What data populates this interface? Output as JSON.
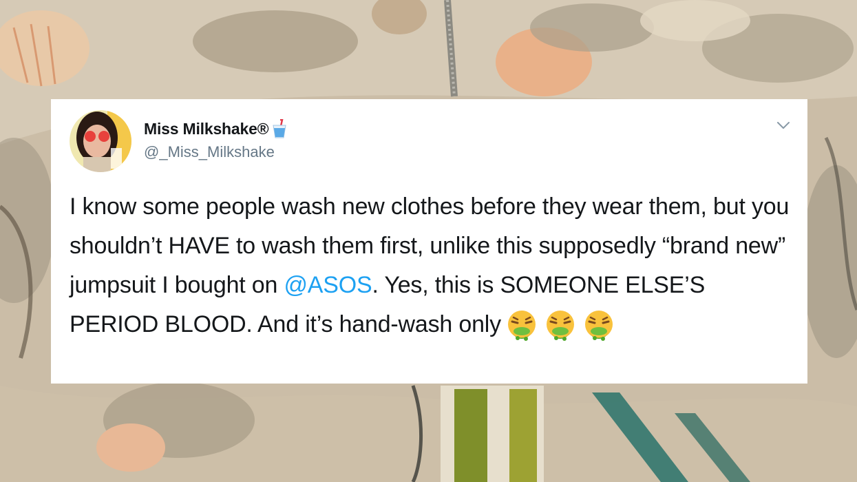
{
  "tweet": {
    "display_name": "Miss Milkshake®",
    "name_emoji": "cup-with-straw-icon",
    "handle": "@_Miss_Milkshake",
    "text_before_mention": "I know some people wash new clothes before they wear them, but you shouldn’t HAVE to wash them first, unlike this supposedly “brand new” jumpsuit I bought on ",
    "mention": "@ASOS",
    "text_after_mention": ". Yes, this is SOMEONE ELSE’S PERIOD BLOOD. And it’s hand-wash only",
    "trailing_emoji": [
      "face-vomiting-icon",
      "face-vomiting-icon",
      "face-vomiting-icon"
    ]
  },
  "colors": {
    "mention": "#1da1f2",
    "text": "#14171a",
    "handle": "#657786",
    "card_background": "#ffffff"
  }
}
